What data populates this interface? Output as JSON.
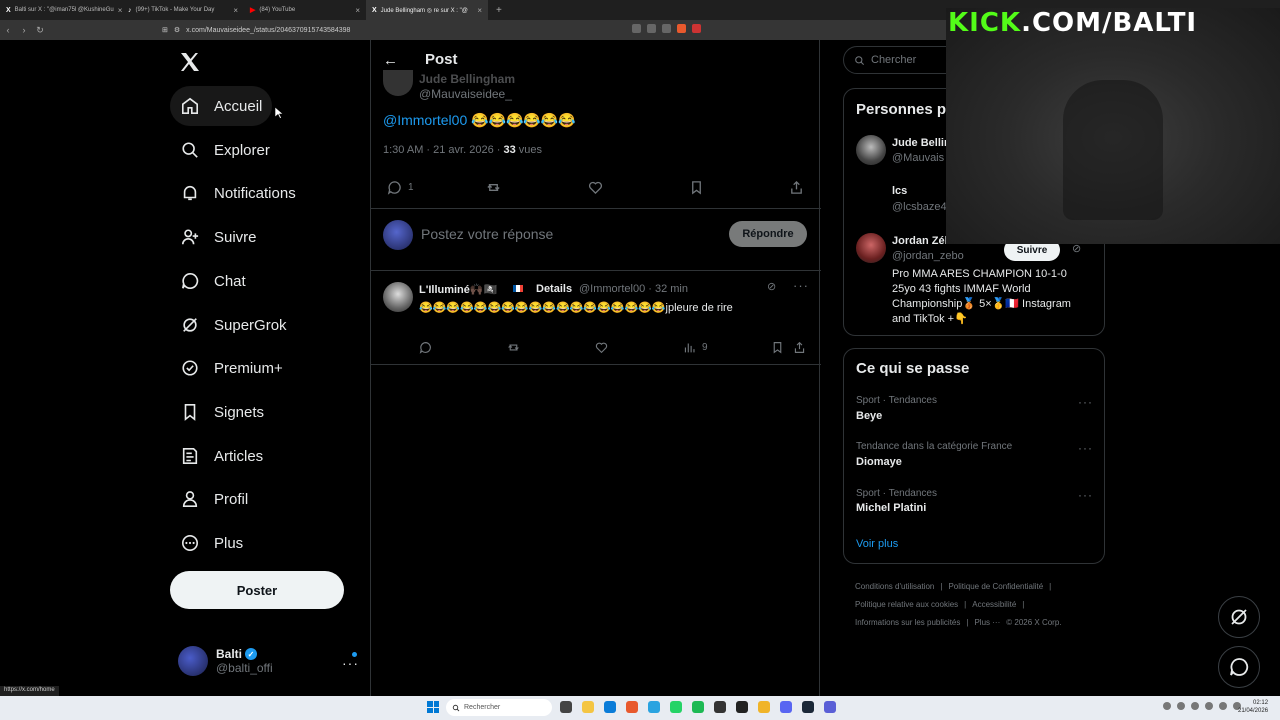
{
  "browser": {
    "tabs": [
      {
        "icon": "X",
        "label": "Balti sur X : \"@iman75l @KushineGu"
      },
      {
        "icon": "♪",
        "label": "(99+) TikTok - Make Your Day"
      },
      {
        "icon": "▶",
        "label": "(84) YouTube"
      },
      {
        "icon": "X",
        "label": "Jude Bellingham ◎ re sur X : \"@"
      }
    ],
    "url": "x.com/Mauvaiseidee_/status/2046370915743584398",
    "status_url": "https://x.com/home"
  },
  "sidebar": {
    "items": [
      {
        "label": "Accueil",
        "icon": "home-icon"
      },
      {
        "label": "Explorer",
        "icon": "search-icon"
      },
      {
        "label": "Notifications",
        "icon": "bell-icon"
      },
      {
        "label": "Suivre",
        "icon": "person-plus-icon"
      },
      {
        "label": "Chat",
        "icon": "chat-bubble-icon"
      },
      {
        "label": "SuperGrok",
        "icon": "grok-icon"
      },
      {
        "label": "Premium+",
        "icon": "verified-badge-icon"
      },
      {
        "label": "Signets",
        "icon": "bookmark-icon"
      },
      {
        "label": "Articles",
        "icon": "article-icon"
      },
      {
        "label": "Profil",
        "icon": "person-icon"
      },
      {
        "label": "Plus",
        "icon": "more-circle-icon"
      }
    ],
    "post_button": "Poster",
    "account": {
      "name": "Balti",
      "handle": "@balti_offi"
    }
  },
  "main": {
    "title": "Post",
    "original": {
      "name": "Jude Bellingham",
      "handle": "@Mauvaiseidee_",
      "mention": "@Immortel00",
      "emojis": "😂😂😂😂😂😂",
      "time": "1:30 AM · 21 avr. 2026 · ",
      "views_count": "33",
      "views_label": " vues",
      "reply_count": "1"
    },
    "composer": {
      "placeholder": "Postez votre réponse",
      "button": "Répondre"
    },
    "reply": {
      "name": "L'Illuminé🙌🏿🏴‍☠️",
      "details": "Details",
      "handle": "@Immortel00 · 32 min",
      "text": "😂😂😂😂😂😂😂😂😂😂😂😂😂😂😂😂😂😂jpleure de rire",
      "views": "9"
    }
  },
  "right": {
    "search_placeholder": "Chercher",
    "who_to_follow_title": "Personnes p",
    "suggestions": [
      {
        "name": "Jude Bellin",
        "handle": "@Mauvais"
      },
      {
        "name": "lcs",
        "handle": "@lcsbaze4"
      },
      {
        "name": "Jordan Zéb",
        "handle": "@jordan_zebo",
        "follow": "Suivre",
        "bio": "Pro MMA ARES CHAMPION 10-1-0 25yo 43 fights IMMAF World Championship🥉 5×🥇🇫🇷 Instagram and TikTok +👇"
      }
    ],
    "trends_title": "Ce qui se passe",
    "trends": [
      {
        "category": "Sport · Tendances",
        "name": "Beye"
      },
      {
        "category": "Tendance dans la catégorie France",
        "name": "Diomaye"
      },
      {
        "category": "Sport · Tendances",
        "name": "Michel Platini"
      }
    ],
    "see_more": "Voir plus",
    "footer": [
      "Conditions d'utilisation",
      "|",
      "Politique de Confidentialité",
      "|",
      "Politique relative aux cookies",
      "|",
      "Accessibilité",
      "|",
      "Informations sur les publicités",
      "|",
      "Plus ···",
      "© 2026 X Corp."
    ]
  },
  "overlay": {
    "kick_brand": "KICK",
    "kick_rest": ".COM/BALTI"
  },
  "taskbar": {
    "search": "Rechercher",
    "time": "02:12",
    "date": "21/04/2026"
  }
}
